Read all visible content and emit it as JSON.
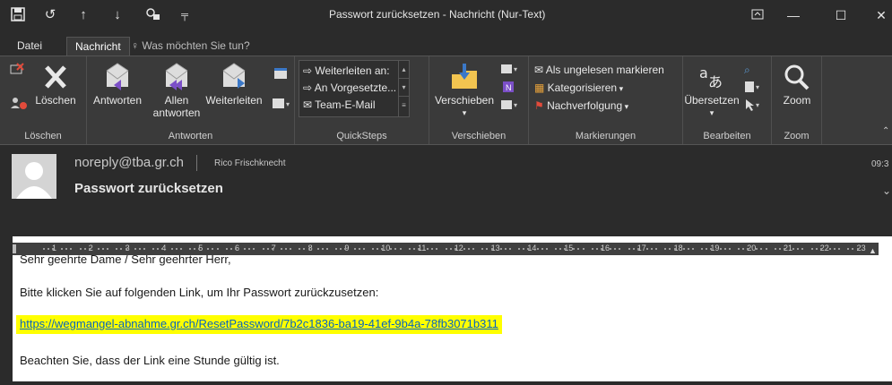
{
  "window": {
    "title": "Passwort zurücksetzen  - Nachricht (Nur-Text)",
    "quick_access": [
      "save-icon",
      "undo-icon",
      "up-arrow-icon",
      "down-arrow-icon",
      "quick-access-icon",
      "customize-icon"
    ],
    "controls": [
      "ribbon-display-icon",
      "minimize-icon",
      "maximize-icon",
      "close-icon"
    ]
  },
  "tabs": [
    {
      "label": "Datei",
      "active": false
    },
    {
      "label": "Nachricht",
      "active": true
    }
  ],
  "tell_me": "Was möchten Sie tun?",
  "ribbon": {
    "loeschen_group": {
      "label": "Löschen",
      "delete_label": "Löschen"
    },
    "antworten_group": {
      "label": "Antworten",
      "reply": "Antworten",
      "reply_all_line1": "Allen",
      "reply_all_line2": "antworten",
      "forward": "Weiterleiten"
    },
    "quicksteps_group": {
      "label": "QuickSteps",
      "items": [
        "Weiterleiten an:",
        "An Vorgesetzte...",
        "Team-E-Mail"
      ]
    },
    "verschieben_group": {
      "label": "Verschieben",
      "move": "Verschieben"
    },
    "markierungen_group": {
      "label": "Markierungen",
      "items": [
        "Als ungelesen markieren",
        "Kategorisieren",
        "Nachverfolgung"
      ]
    },
    "bearbeiten_group": {
      "label": "Bearbeiten",
      "translate": "Übersetzen"
    },
    "zoom_group": {
      "label": "Zoom",
      "zoom": "Zoom"
    }
  },
  "message": {
    "sender": "noreply@tba.gr.ch",
    "recipient": "Rico Frischknecht",
    "subject": "Passwort zurücksetzen",
    "time": "09:3"
  },
  "ruler": {
    "numbers": [
      "1",
      "2",
      "3",
      "4",
      "5",
      "6",
      "7",
      "8",
      "9",
      "10",
      "11",
      "12",
      "13",
      "14",
      "15",
      "16",
      "17",
      "18",
      "19",
      "20",
      "21",
      "22",
      "23"
    ]
  },
  "body": {
    "greeting": "Sehr geehrte Dame / Sehr geehrter Herr,",
    "instruction": "Bitte klicken Sie auf folgenden Link, um Ihr Passwort zurückzusetzen:",
    "link": "https://wegmangel-abnahme.gr.ch/ResetPassword/7b2c1836-ba19-41ef-9b4a-78fb3071b311",
    "note": "Beachten Sie, dass der Link eine Stunde gültig ist."
  },
  "colors": {
    "link_highlight": "#ffff00",
    "link_text": "#0563c1",
    "ribbon_bg": "#3a3a3a",
    "titlebar_bg": "#2b2b2b"
  }
}
